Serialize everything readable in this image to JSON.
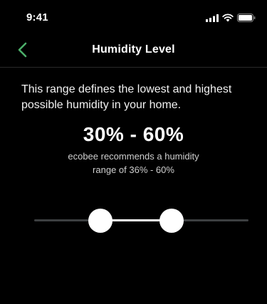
{
  "status_bar": {
    "time": "9:41",
    "signal_icon": "cellular-signal-icon",
    "wifi_icon": "wifi-icon",
    "battery_icon": "battery-icon"
  },
  "nav": {
    "back_icon": "chevron-left-icon",
    "title": "Humidity Level"
  },
  "description": "This range defines the lowest and highest possible humidity in your home.",
  "range_display": "30% - 60%",
  "recommendation": "ecobee recommends a humidity range of 36% - 60%",
  "slider": {
    "min_thumb_fraction": 0.31,
    "max_thumb_fraction": 0.64
  },
  "colors": {
    "background": "#000000",
    "back_chevron": "#4caf6a",
    "track": "#3d3f41",
    "track_active": "#ffffff"
  }
}
